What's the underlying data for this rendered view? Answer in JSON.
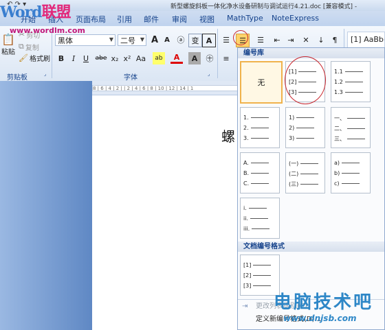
{
  "window": {
    "title": "新型螺旋斜板一体化净水设备研制与调试运行4.21.doc [兼容模式] -",
    "qat_icons": "↶ ↷ ▾"
  },
  "logo": {
    "word": "Word",
    "cn": "联盟",
    "url": "www.wordlm.com"
  },
  "tabs": [
    "开始",
    "插入",
    "页面布局",
    "引用",
    "邮件",
    "审阅",
    "视图",
    "MathType",
    "NoteExpress"
  ],
  "clipboard": {
    "paste": "粘贴",
    "cut": "剪切",
    "copy": "复制",
    "format_painter": "格式刷",
    "group_label": "剪贴板"
  },
  "font": {
    "name": "黑体",
    "size": "二号",
    "grow": "A",
    "shrink": "A",
    "clear": "ⓐ",
    "wen": "变",
    "border_a": "A",
    "bold": "B",
    "italic": "I",
    "underline": "U",
    "strike": "abe",
    "sub": "x₂",
    "sup": "x²",
    "case": "Aa",
    "highlight": "ab",
    "color": "A",
    "shade": "A",
    "enclose": "㊉",
    "group_label": "字体"
  },
  "paragraph": {
    "bullets": "☰",
    "numbering": "☰",
    "multilevel": "☰",
    "decrease_indent": "⇤",
    "increase_indent": "⇥",
    "asian": "✕",
    "sort": "↓",
    "marks": "¶"
  },
  "styles": {
    "preview": "[1] AaBb("
  },
  "ruler": {
    "text": "8 | 6 | 4 | 2 |      | 2 | 4 | 6 | 8 | 10 | 12 | 14 | 1"
  },
  "document": {
    "visible_char": "螺"
  },
  "dropdown": {
    "library_header": "编号库",
    "none_label": "无",
    "tiles": [
      [
        "[1]",
        "[2]",
        "[3]"
      ],
      [
        "1.1",
        "1.2",
        "1.3"
      ],
      [
        "1.",
        "2.",
        "3."
      ],
      [
        "1)",
        "2)",
        "3)"
      ],
      [
        "一、",
        "二、",
        "三、"
      ],
      [
        "A.",
        "B.",
        "C."
      ],
      [
        "(一)",
        "(二)",
        "(三)"
      ],
      [
        "a)",
        "b)",
        "c)"
      ],
      [
        "i.",
        "ii.",
        "iii."
      ]
    ],
    "doc_header": "文档编号格式",
    "doc_tile": [
      "[1]",
      "[2]",
      "[3]"
    ],
    "change_level": "更改列表级别(C)",
    "define_new": "定义新编号格式(D)..."
  },
  "watermark": {
    "cn": "电脑技术吧",
    "url": "www.dnjsb.com"
  },
  "colors": {
    "ribbon": "#dfe8f5",
    "accent": "#15428b",
    "annotation": "#c8262e",
    "selected_tile": "#f0b24b"
  }
}
